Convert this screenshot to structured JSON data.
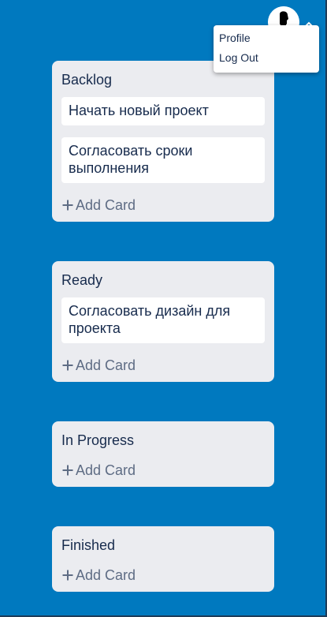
{
  "user_menu": {
    "items": [
      {
        "label": "Profile"
      },
      {
        "label": "Log Out"
      }
    ]
  },
  "columns": [
    {
      "title": "Backlog",
      "cards": [
        {
          "text": "Начать новый проект"
        },
        {
          "text": "Согласовать сроки выполнения"
        }
      ],
      "add_label": "Add Card"
    },
    {
      "title": "Ready",
      "cards": [
        {
          "text": "Согласовать дизайн для проекта"
        }
      ],
      "add_label": "Add Card"
    },
    {
      "title": "In Progress",
      "cards": [],
      "add_label": "Add Card"
    },
    {
      "title": "Finished",
      "cards": [],
      "add_label": "Add Card"
    }
  ],
  "colors": {
    "board_background": "#0079bf",
    "column_background": "#ebecf0",
    "card_background": "#ffffff",
    "muted_text": "#5e6c84"
  },
  "icons": {
    "avatar": "user-silhouette-icon",
    "menu_toggle": "chevron-up-icon",
    "add": "plus-icon"
  }
}
